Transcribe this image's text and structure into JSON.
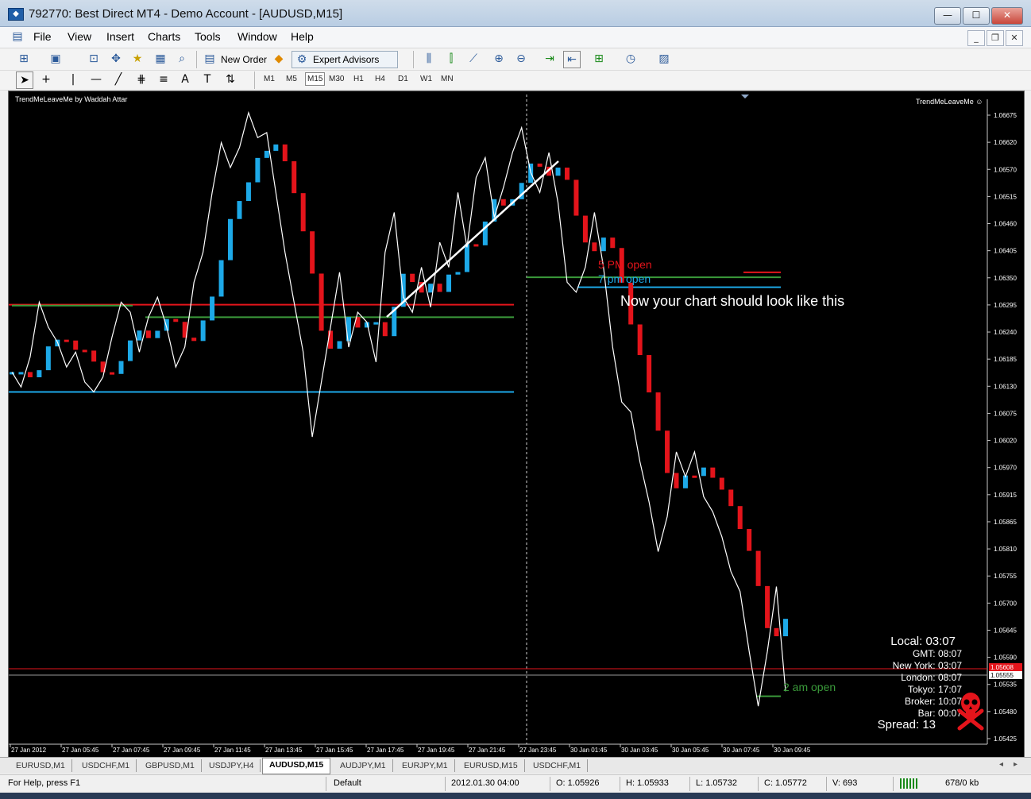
{
  "window": {
    "title": "792770: Best Direct MT4 - Demo Account - [AUDUSD,M15]",
    "minimize": "—",
    "maximize": "☐",
    "close": "✕"
  },
  "menu": {
    "items": [
      "File",
      "View",
      "Insert",
      "Charts",
      "Tools",
      "Window",
      "Help"
    ],
    "mdi_minimize": "_",
    "mdi_restore": "❐",
    "mdi_close": "✕"
  },
  "toolbar": {
    "new_order": "New Order",
    "expert_advisors": "Expert Advisors",
    "timeframes": [
      "M1",
      "M5",
      "M15",
      "M30",
      "H1",
      "H4",
      "D1",
      "W1",
      "MN"
    ],
    "active_timeframe": "M15",
    "text_tool": "A"
  },
  "chart": {
    "indicator_label": "TrendMeLeaveMe by Waddah Attar",
    "indicator_label_right": "TrendMeLeaveMe ☺",
    "annotation": "Now your chart should look like this",
    "label_5pm": "5 PM open",
    "label_7pm": "7 pm open",
    "label_2am": "2 am open",
    "price_badge_red": "1.05608",
    "price_badge_white": "1.05555",
    "info": {
      "local": "Local: 03:07",
      "gmt": "GMT: 08:07",
      "newyork": "New York: 03:07",
      "london": "London: 08:07",
      "tokyo": "Tokyo: 17:07",
      "broker": "Broker: 10:07",
      "bar": "Bar: 00:07",
      "spread": "Spread: 13"
    },
    "skull_icon": "skull-crossbones",
    "colors": {
      "up": "#1da9e8",
      "down": "#e4141b",
      "price_line": "#ffffff",
      "green_level": "#3a9a3a"
    }
  },
  "chart_data": {
    "type": "line",
    "y_ticks": [
      "1.06675",
      "1.06620",
      "1.06570",
      "1.06515",
      "1.06460",
      "1.06405",
      "1.06350",
      "1.06295",
      "1.06240",
      "1.06185",
      "1.06130",
      "1.06075",
      "1.06020",
      "1.05970",
      "1.05915",
      "1.05865",
      "1.05810",
      "1.05755",
      "1.05700",
      "1.05645",
      "1.05590",
      "1.05535",
      "1.05480",
      "1.05425"
    ],
    "x_ticks": [
      "27 Jan 2012",
      "27 Jan 05:45",
      "27 Jan 07:45",
      "27 Jan 09:45",
      "27 Jan 11:45",
      "27 Jan 13:45",
      "27 Jan 15:45",
      "27 Jan 17:45",
      "27 Jan 19:45",
      "27 Jan 21:45",
      "27 Jan 23:45",
      "30 Jan 01:45",
      "30 Jan 03:45",
      "30 Jan 05:45",
      "30 Jan 07:45",
      "30 Jan 09:45"
    ],
    "ylim": [
      1.05425,
      1.06675
    ],
    "series": [
      {
        "values": [
          1.0616,
          1.0613,
          1.0619,
          1.063,
          1.0625,
          1.0622,
          1.0617,
          1.062,
          1.0614,
          1.0612,
          1.0615,
          1.0623,
          1.063,
          1.0628,
          1.062,
          1.0627,
          1.0631,
          1.0625,
          1.0617,
          1.0621,
          1.0634,
          1.064,
          1.0652,
          1.0662,
          1.0657,
          1.0661,
          1.0668,
          1.0663,
          1.0664,
          1.0652,
          1.064,
          1.063,
          1.062,
          1.0603,
          1.0614,
          1.0625,
          1.0636,
          1.0621,
          1.0628,
          1.0626,
          1.0618,
          1.064,
          1.0648,
          1.0631,
          1.0628,
          1.0637,
          1.0629,
          1.0642,
          1.0637,
          1.0652,
          1.0641,
          1.0655,
          1.0659,
          1.0647,
          1.0653,
          1.066,
          1.0665,
          1.0656,
          1.0652,
          1.066,
          1.065,
          1.0634,
          1.0632,
          1.0637,
          1.0648,
          1.0637,
          1.0621,
          1.061,
          1.0608,
          1.0598,
          1.059,
          1.058,
          1.0587,
          1.06,
          1.0595,
          1.06,
          1.0591,
          1.0588,
          1.0583,
          1.0576,
          1.0572,
          1.056,
          1.0549,
          1.056,
          1.0573,
          1.0552
        ],
        "name": ""
      }
    ],
    "horizontal_levels": [
      {
        "price": 1.06295,
        "color": "red"
      },
      {
        "price": 1.0612,
        "color": "blue"
      },
      {
        "price": 1.0627,
        "color": "green"
      },
      {
        "price": 1.0635,
        "color": "green"
      },
      {
        "price": 1.0636,
        "color": "red"
      },
      {
        "price": 1.0633,
        "color": "blue"
      },
      {
        "price": 1.0551,
        "color": "green"
      }
    ]
  },
  "tabs": [
    "EURUSD,M1",
    "USDCHF,M1",
    "GBPUSD,M1",
    "USDJPY,H4",
    "AUDUSD,M15",
    "AUDJPY,M1",
    "EURJPY,M1",
    "EURUSD,M15",
    "USDCHF,M1"
  ],
  "active_tab": "AUDUSD,M15",
  "status": {
    "help": "For Help, press F1",
    "profile": "Default",
    "datetime": "2012.01.30 04:00",
    "open": "O: 1.05926",
    "high": "H: 1.05933",
    "low": "L: 1.05732",
    "close": "C: 1.05772",
    "volume": "V: 693",
    "traffic": "678/0 kb"
  }
}
